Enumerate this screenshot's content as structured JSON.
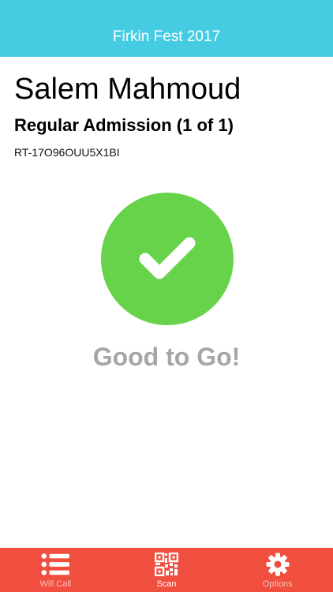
{
  "header": {
    "title": "Firkin Fest 2017"
  },
  "ticket": {
    "attendee_name": "Salem Mahmoud",
    "type": "Regular Admission (1 of 1)",
    "code": "RT-17O96OUU5X1BI"
  },
  "status": {
    "icon": "checkmark-icon",
    "message": "Good to Go!",
    "color": "#66d34a"
  },
  "tabbar": {
    "background": "#f04e3e",
    "items": [
      {
        "label": "Will Call",
        "icon": "list-icon",
        "active": false
      },
      {
        "label": "Scan",
        "icon": "qr-code-icon",
        "active": true
      },
      {
        "label": "Options",
        "icon": "gear-icon",
        "active": false
      }
    ]
  }
}
